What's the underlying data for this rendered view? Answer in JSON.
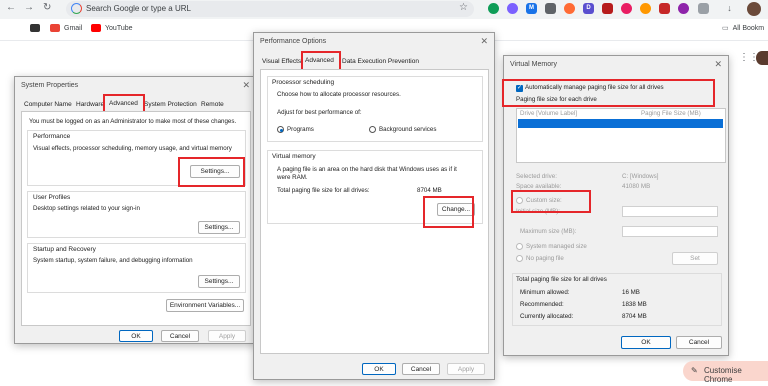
{
  "browser": {
    "omnibox_placeholder": "Search Google or type a URL",
    "bookmarks": [
      "Gmail",
      "YouTube"
    ],
    "all_bookmarks": "All Bookm",
    "customise": "Customise Chrome"
  },
  "system_properties": {
    "title": "System Properties",
    "tabs": [
      "Computer Name",
      "Hardware",
      "Advanced",
      "System Protection",
      "Remote"
    ],
    "admin_note": "You must be logged on as an Administrator to make most of these changes.",
    "performance": {
      "title": "Performance",
      "desc": "Visual effects, processor scheduling, memory usage, and virtual memory",
      "button": "Settings..."
    },
    "user_profiles": {
      "title": "User Profiles",
      "desc": "Desktop settings related to your sign-in",
      "button": "Settings..."
    },
    "startup": {
      "title": "Startup and Recovery",
      "desc": "System startup, system failure, and debugging information",
      "button": "Settings..."
    },
    "env_button": "Environment Variables...",
    "ok": "OK",
    "cancel": "Cancel",
    "apply": "Apply"
  },
  "performance_options": {
    "title": "Performance Options",
    "tabs": [
      "Visual Effects",
      "Advanced",
      "Data Execution Prevention"
    ],
    "processor": {
      "title": "Processor scheduling",
      "desc": "Choose how to allocate processor resources.",
      "adjust": "Adjust for best performance of:",
      "opt1": "Programs",
      "opt2": "Background services"
    },
    "virtual_memory": {
      "title": "Virtual memory",
      "desc1": "A paging file is an area on the hard disk that Windows uses as if it",
      "desc2": "were RAM.",
      "total_label": "Total paging file size for all drives:",
      "total_value": "8704 MB",
      "button": "Change..."
    },
    "ok": "OK",
    "cancel": "Cancel",
    "apply": "Apply"
  },
  "virtual_memory": {
    "title": "Virtual Memory",
    "auto_manage": "Automatically manage paging file size for all drives",
    "paging_each": "Paging file size for each drive",
    "col_drive": "Drive  [Volume Label]",
    "col_size": "Paging File Size (MB)",
    "selected_drive_label": "Selected drive:",
    "selected_drive_value": "C:  [Windows]",
    "space_label": "Space available:",
    "space_value": "41080 MB",
    "custom_size": "Custom size:",
    "initial_size": "Initial size (MB):",
    "max_size": "Maximum size (MB):",
    "system_managed": "System managed size",
    "no_paging": "No paging file",
    "set": "Set",
    "totals_title": "Total paging file size for all drives",
    "min_label": "Minimum allowed:",
    "min_value": "16 MB",
    "rec_label": "Recommended:",
    "rec_value": "1838 MB",
    "cur_label": "Currently allocated:",
    "cur_value": "8704 MB",
    "ok": "OK",
    "cancel": "Cancel"
  },
  "colors": {
    "highlight": "#e5262a",
    "accent": "#0067c0"
  }
}
